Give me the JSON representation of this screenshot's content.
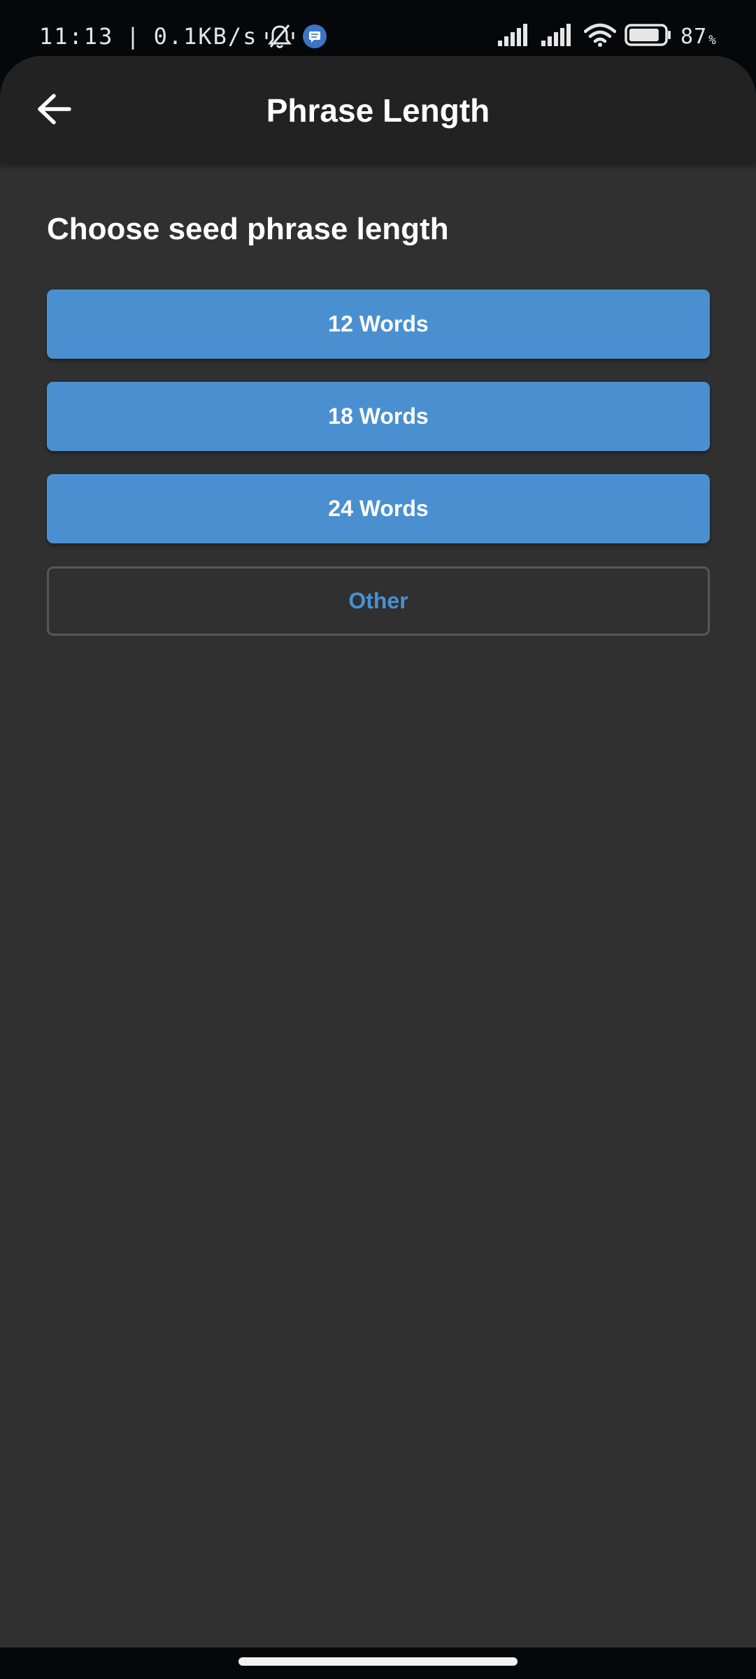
{
  "status_bar": {
    "time": "11:13",
    "separator": "|",
    "network_speed": "0.1KB/s",
    "battery_percent": "87",
    "battery_unit": "%",
    "battery_level": 0.87,
    "icons": [
      "alarm-off-icon",
      "message-icon",
      "signal-icon",
      "signal-icon",
      "wifi-icon",
      "battery-icon"
    ]
  },
  "header": {
    "back_icon": "arrow-left-icon",
    "title": "Phrase Length"
  },
  "main": {
    "prompt": "Choose seed phrase length",
    "options": [
      {
        "label": "12 Words",
        "style": "filled"
      },
      {
        "label": "18 Words",
        "style": "filled"
      },
      {
        "label": "24 Words",
        "style": "filled"
      },
      {
        "label": "Other",
        "style": "outline"
      }
    ]
  },
  "colors": {
    "accent": "#4a90d0",
    "background": "#303030",
    "app_bar": "#222222",
    "outline_border": "#575757"
  }
}
